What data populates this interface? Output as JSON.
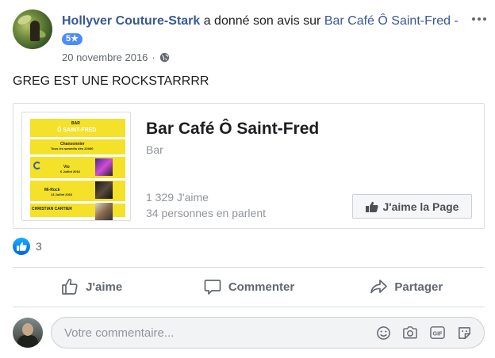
{
  "post": {
    "author": "Hollyver Couture-Stark",
    "action_text": " a donné son avis sur ",
    "page_link": "Bar Café Ô Saint-Fred",
    "dash": " - ",
    "rating": "5★",
    "date": "20 novembre 2016",
    "separator": "·",
    "privacy_icon": "globe-icon",
    "text": "GREG EST UNE ROCKSTARRRR"
  },
  "page_card": {
    "name": "Bar Café Ô Saint-Fred",
    "category": "Bar",
    "likes": "1 329 J'aime",
    "talking": "34 personnes en parlent",
    "like_button": "J'aime la Page",
    "poster": {
      "top": "BAR",
      "title": "Ô SAINT-FRED",
      "line1": "Chansonnier",
      "line2": "Tous les samedis dès 22h00",
      "act1": "Vio",
      "date1": "6 Juillet 2016",
      "act2": "Mi-Rock",
      "date2": "13 Juillet 2016",
      "act3": "CHRISTIAN CARTIER"
    }
  },
  "reactions": {
    "icon": "like-icon",
    "count": "3"
  },
  "actions": {
    "like": "J'aime",
    "comment": "Commenter",
    "share": "Partager"
  },
  "comment": {
    "placeholder": "Votre commentaire..."
  },
  "colors": {
    "link": "#385898",
    "badge": "#4c8cf5",
    "poster": "#f3e12a",
    "like_reaction": "#1877f2"
  }
}
